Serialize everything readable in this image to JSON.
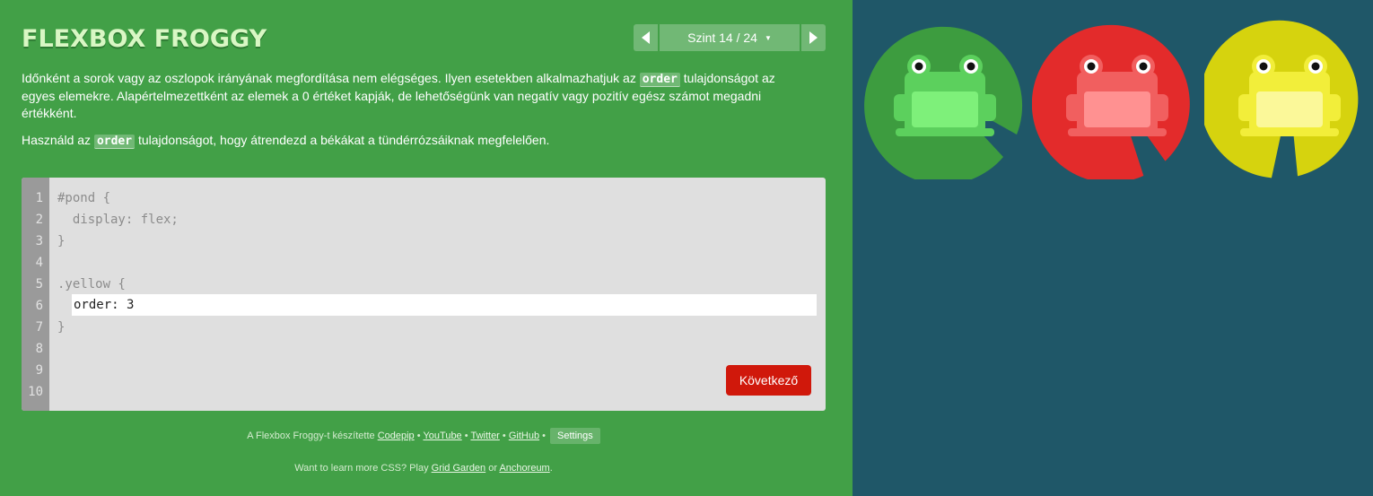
{
  "header": {
    "logo": "FLEXBOX FROGGY",
    "level_label": "Szint 14 / 24",
    "level_caret": "▼"
  },
  "instructions": {
    "p1_before": "Időnként a sorok vagy az oszlopok irányának megfordítása nem elégséges. Ilyen esetekben alkalmazhatjuk az ",
    "p1_code": "order",
    "p1_after": " tulajdonságot az egyes elemekre. Alapértelmezettként az elemek a 0 értéket kapják, de lehetőségünk van negatív vagy pozitív egész számot megadni értékként.",
    "p2_before": "Használd az ",
    "p2_code": "order",
    "p2_after": " tulajdonságot, hogy átrendezd a békákat a tündérrózsáiknak megfelelően."
  },
  "editor": {
    "line_numbers": [
      "1",
      "2",
      "3",
      "4",
      "5",
      "6",
      "7",
      "8",
      "9",
      "10"
    ],
    "code_before": "#pond {\n  display: flex;\n}\n\n.yellow {",
    "code_after": "}",
    "input_value": "order: 3",
    "next_label": "Következő"
  },
  "credits": {
    "prefix": "A Flexbox Froggy-t készítette ",
    "codepip": "Codepip",
    "youtube": "YouTube",
    "twitter": "Twitter",
    "github": "GitHub",
    "separator": " • ",
    "settings": "Settings"
  },
  "footer": {
    "prefix": "Want to learn more CSS? Play ",
    "grid_garden": "Grid Garden",
    "or": " or ",
    "anchoreum": "Anchoreum",
    "suffix": "."
  },
  "pond": {
    "background": "#1f5768",
    "frogs": [
      {
        "color": "green",
        "lily": "#3d9c3f",
        "body": "#5cd05d",
        "belly": "#7ef07a"
      },
      {
        "color": "red",
        "lily": "#e32b2b",
        "body": "#f15f5f",
        "belly": "#ff9191"
      },
      {
        "color": "yellow",
        "lily": "#d6d30e",
        "body": "#f2ee3a",
        "belly": "#fbf899"
      }
    ]
  }
}
